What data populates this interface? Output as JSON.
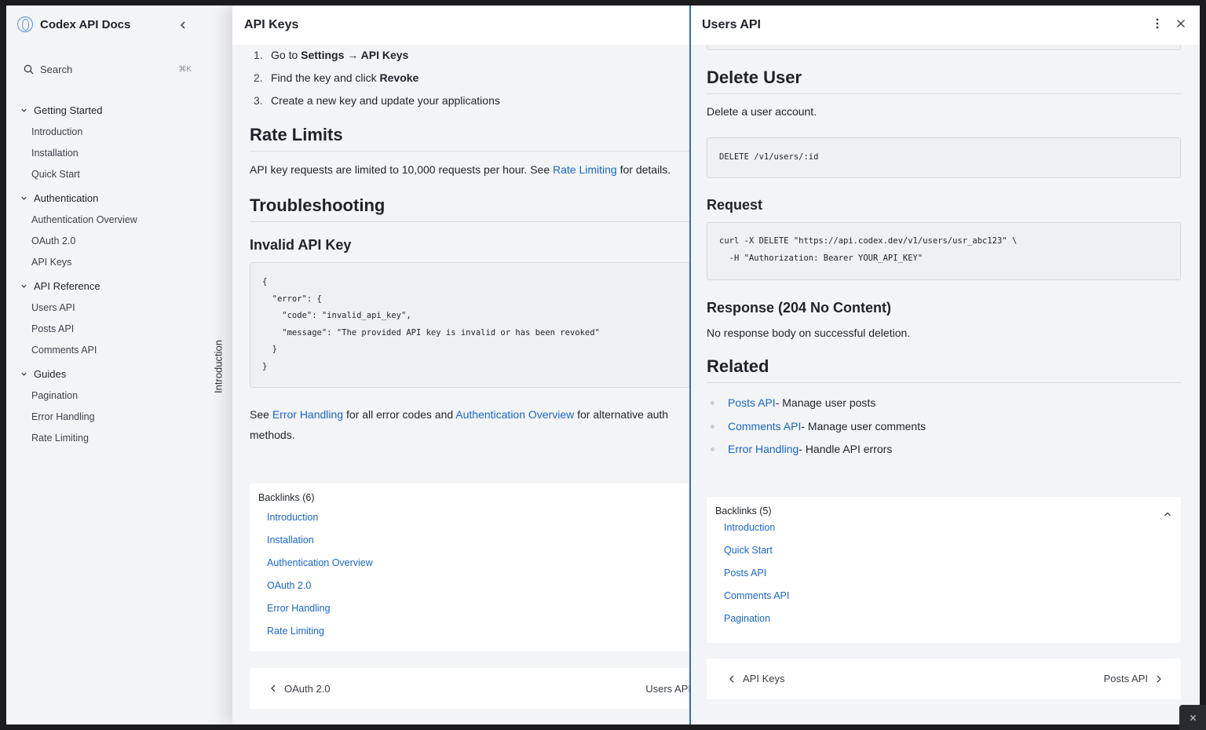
{
  "sidebar": {
    "app_name": "Codex API Docs",
    "search_label": "Search",
    "search_shortcut": "⌘K",
    "groups": [
      {
        "label": "Getting Started",
        "items": [
          "Introduction",
          "Installation",
          "Quick Start"
        ]
      },
      {
        "label": "Authentication",
        "items": [
          "Authentication Overview",
          "OAuth 2.0",
          "API Keys"
        ]
      },
      {
        "label": "API Reference",
        "items": [
          "Users API",
          "Posts API",
          "Comments API"
        ]
      },
      {
        "label": "Guides",
        "items": [
          "Pagination",
          "Error Handling",
          "Rate Limiting"
        ]
      }
    ]
  },
  "collapsed_tab": {
    "label": "Introduction"
  },
  "main_pane": {
    "title": "API Keys",
    "steps": [
      {
        "num": "1.",
        "pre": "Go to ",
        "bold": "Settings → API Keys",
        "post": ""
      },
      {
        "num": "2.",
        "pre": "Find the key and click ",
        "bold": "Revoke",
        "post": ""
      },
      {
        "num": "3.",
        "pre": "Create a new key and update your applications",
        "bold": "",
        "post": ""
      }
    ],
    "rate_limits": {
      "heading": "Rate Limits",
      "text_pre": "API key requests are limited to 10,000 requests per hour. See ",
      "link": "Rate Limiting",
      "text_post": " for details."
    },
    "troubleshooting": {
      "heading": "Troubleshooting",
      "subheading": "Invalid API Key",
      "code": "{\n  \"error\": {\n    \"code\": \"invalid_api_key\",\n    \"message\": \"The provided API key is invalid or has been revoked\"\n  }\n}",
      "see_pre": "See ",
      "link1": "Error Handling",
      "see_mid": " for all error codes and ",
      "link2": "Authentication Overview",
      "see_post": " for alternative auth methods."
    },
    "backlinks": {
      "title": "Backlinks (6)",
      "links": [
        "Introduction",
        "Installation",
        "Authentication Overview",
        "OAuth 2.0",
        "Error Handling",
        "Rate Limiting"
      ]
    },
    "pager": {
      "prev": "OAuth 2.0",
      "next": "Users API"
    }
  },
  "right_pane": {
    "title": "Users API",
    "delete_user": {
      "heading": "Delete User",
      "desc": "Delete a user account.",
      "endpoint": "DELETE /v1/users/:id"
    },
    "request": {
      "heading": "Request",
      "code": "curl -X DELETE \"https://api.codex.dev/v1/users/usr_abc123\" \\\n  -H \"Authorization: Bearer YOUR_API_KEY\""
    },
    "response": {
      "heading": "Response (204 No Content)",
      "text": "No response body on successful deletion."
    },
    "related": {
      "heading": "Related",
      "items": [
        {
          "link": "Posts API",
          "desc": " - Manage user posts"
        },
        {
          "link": "Comments API",
          "desc": " - Manage user comments"
        },
        {
          "link": "Error Handling",
          "desc": " - Handle API errors"
        }
      ]
    },
    "backlinks": {
      "title": "Backlinks (5)",
      "links": [
        "Introduction",
        "Quick Start",
        "Posts API",
        "Comments API",
        "Pagination"
      ]
    },
    "pager": {
      "prev": "API Keys",
      "next": "Posts API"
    }
  },
  "colors": {
    "accent": "#2f6fcc",
    "link": "#1a66c9",
    "background": "#f3f4f6"
  }
}
